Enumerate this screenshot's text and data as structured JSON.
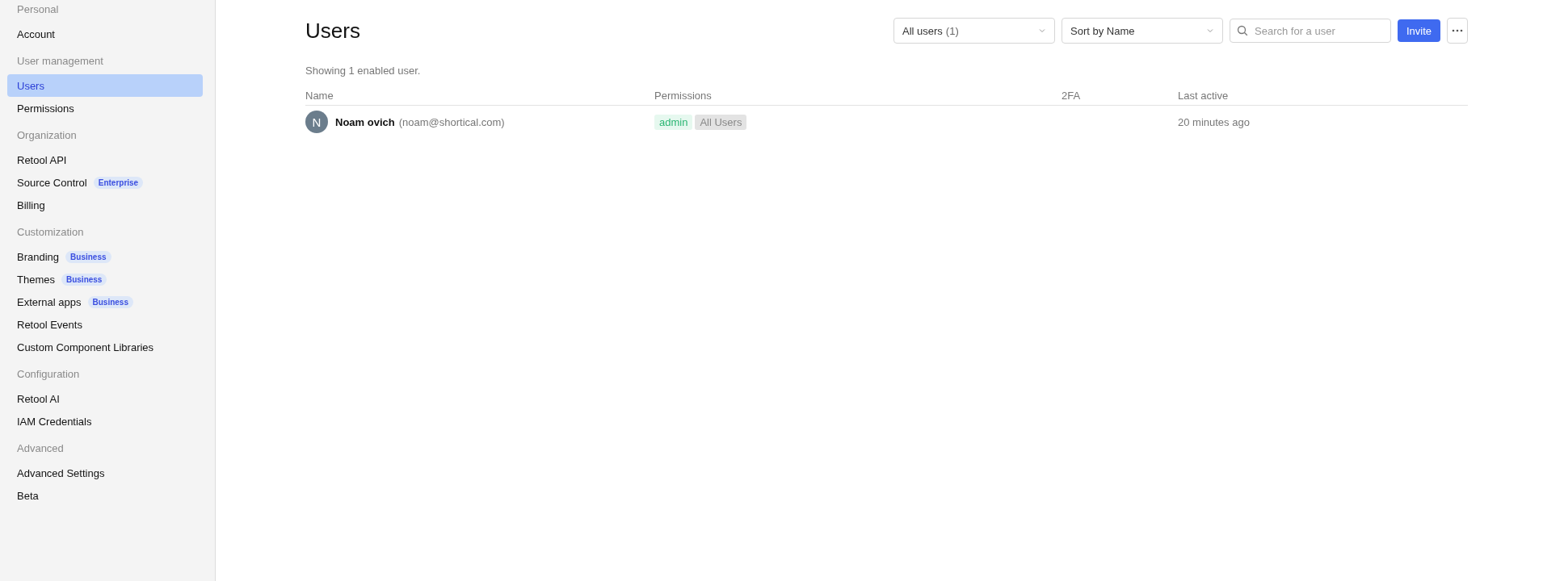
{
  "sidebar": {
    "groups": [
      {
        "label": "Personal",
        "items": [
          {
            "label": "Account",
            "selected": false
          }
        ]
      },
      {
        "label": "User management",
        "items": [
          {
            "label": "Users",
            "selected": true
          },
          {
            "label": "Permissions",
            "selected": false
          }
        ]
      },
      {
        "label": "Organization",
        "items": [
          {
            "label": "Retool API",
            "selected": false
          },
          {
            "label": "Source Control",
            "selected": false,
            "badge": "Enterprise"
          },
          {
            "label": "Billing",
            "selected": false
          }
        ]
      },
      {
        "label": "Customization",
        "items": [
          {
            "label": "Branding",
            "selected": false,
            "badge": "Business"
          },
          {
            "label": "Themes",
            "selected": false,
            "badge": "Business"
          },
          {
            "label": "External apps",
            "selected": false,
            "badge": "Business"
          },
          {
            "label": "Retool Events",
            "selected": false
          },
          {
            "label": "Custom Component Libraries",
            "selected": false
          }
        ]
      },
      {
        "label": "Configuration",
        "items": [
          {
            "label": "Retool AI",
            "selected": false
          },
          {
            "label": "IAM Credentials",
            "selected": false
          }
        ]
      },
      {
        "label": "Advanced",
        "items": [
          {
            "label": "Advanced Settings",
            "selected": false
          },
          {
            "label": "Beta",
            "selected": false
          }
        ]
      }
    ]
  },
  "page": {
    "title": "Users",
    "filter": {
      "value": "All users",
      "count": "(1)"
    },
    "sort": {
      "value": "Sort by Name"
    },
    "search": {
      "placeholder": "Search for a user"
    },
    "invite_button": "Invite",
    "summary": "Showing 1 enabled user.",
    "table": {
      "columns": [
        "Name",
        "Permissions",
        "2FA",
        "Last active"
      ],
      "rows": [
        {
          "avatar": "N",
          "name": "Noam ovich",
          "email": "(noam@shortical.com)",
          "permissions": [
            {
              "label": "admin",
              "kind": "role"
            },
            {
              "label": "All Users",
              "kind": "group"
            }
          ],
          "last_active": "20 minutes ago"
        }
      ]
    }
  }
}
